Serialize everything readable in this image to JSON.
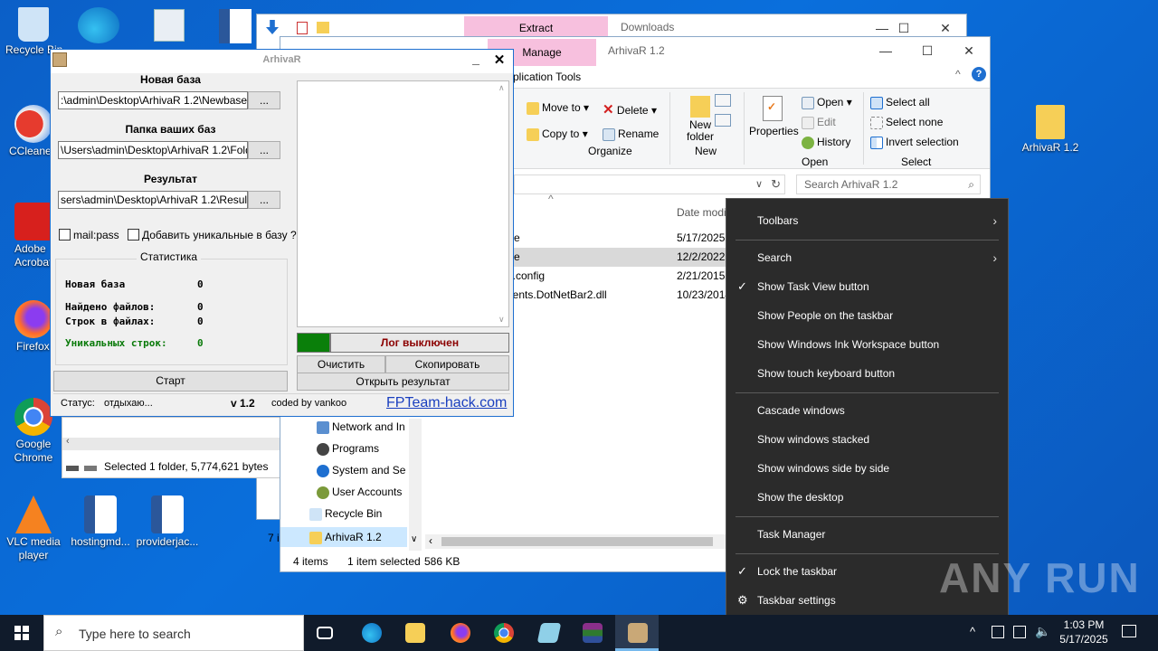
{
  "desktop": {
    "icons": [
      {
        "label": "Recycle Bin"
      },
      {
        "label": "CCleaner"
      },
      {
        "label": "Adobe Acrobat"
      },
      {
        "label": "Firefox"
      },
      {
        "label": "Google Chrome"
      },
      {
        "label": "VLC media player"
      },
      {
        "label": "hostingmd..."
      },
      {
        "label": "providerjac..."
      },
      {
        "label": "ArhivaR 1.2"
      }
    ]
  },
  "explorer_back": {
    "tab_extract": "Extract",
    "title": "Downloads",
    "status": "Selected 1 folder, 5,774,621 bytes",
    "items_label": "7 i"
  },
  "explorer_front": {
    "tab_manage": "Manage",
    "title": "ArhivaR 1.2",
    "app_tools": "plication Tools",
    "ribbon": {
      "move_to": "Move to",
      "copy_to": "Copy to",
      "delete": "Delete",
      "rename": "Rename",
      "new_folder": "New folder",
      "properties": "Properties",
      "open": "Open",
      "edit": "Edit",
      "history": "History",
      "select_all": "Select all",
      "select_none": "Select none",
      "invert_selection": "Invert selection",
      "group_organize": "Organize",
      "group_new": "New",
      "group_open": "Open",
      "group_select": "Select"
    },
    "search_placeholder": "Search ArhivaR 1.2",
    "column_date": "Date modi",
    "files": [
      {
        "name": "e",
        "date": "5/17/2025"
      },
      {
        "name": "e",
        "date": "12/2/2022"
      },
      {
        "name": "e.config",
        "date": "2/21/2015"
      },
      {
        "name": "nents.DotNetBar2.dll",
        "date": "10/23/2014"
      }
    ],
    "nav": [
      {
        "label": "Network and In"
      },
      {
        "label": "Programs"
      },
      {
        "label": "System and Se"
      },
      {
        "label": "User Accounts"
      },
      {
        "label": "Recycle Bin"
      },
      {
        "label": "ArhivaR 1.2"
      }
    ],
    "status_items": "4 items",
    "status_selected": "1 item selected",
    "status_size": "586 KB"
  },
  "arhivar": {
    "title": "ArhivaR",
    "new_base_label": "Новая база",
    "new_base_value": ":\\admin\\Desktop\\ArhivaR 1.2\\Newbase.txt",
    "folder_label": "Папка ваших баз",
    "folder_value": "\\Users\\admin\\Desktop\\ArhivaR 1.2\\Folder",
    "result_label": "Результат",
    "result_value": "sers\\admin\\Desktop\\ArhivaR 1.2\\Result.txt",
    "browse": "...",
    "chk_mailpass": "mail:pass",
    "chk_unique": "Добавить уникальные в базу ?",
    "stats_title": "Статистика",
    "stat_new_base": "Новая база",
    "stat_new_base_val": "0",
    "stat_found": "Найдено файлов:",
    "stat_found_val": "0",
    "stat_lines": "Строк в файлах:",
    "stat_lines_val": "0",
    "stat_unique": "Уникальных строк:",
    "stat_unique_val": "0",
    "start": "Старт",
    "log_status": "Лог выключен",
    "clear": "Очистить",
    "copy": "Скопировать",
    "open_result": "Открыть результат",
    "status_label": "Статус:",
    "status_value": "отдыхаю...",
    "version": "v 1.2",
    "coded_by": "coded by vankoo",
    "link": "FPTeam-hack.com"
  },
  "context_menu": {
    "items": [
      {
        "label": "Toolbars"
      },
      {
        "label": "Search"
      },
      {
        "label": "Show Task View button"
      },
      {
        "label": "Show People on the taskbar"
      },
      {
        "label": "Show Windows Ink Workspace button"
      },
      {
        "label": "Show touch keyboard button"
      },
      {
        "label": "Cascade windows"
      },
      {
        "label": "Show windows stacked"
      },
      {
        "label": "Show windows side by side"
      },
      {
        "label": "Show the desktop"
      },
      {
        "label": "Task Manager"
      },
      {
        "label": "Lock the taskbar"
      },
      {
        "label": "Taskbar settings"
      }
    ]
  },
  "watermark": "ANY RUN",
  "taskbar": {
    "search_placeholder": "Type here to search",
    "time": "1:03 PM",
    "date": "5/17/2025"
  },
  "colors": {
    "accent": "#1e6fd0",
    "log_green": "#008000",
    "log_text": "#8b0000",
    "menu_bg": "#2b2b2b"
  }
}
